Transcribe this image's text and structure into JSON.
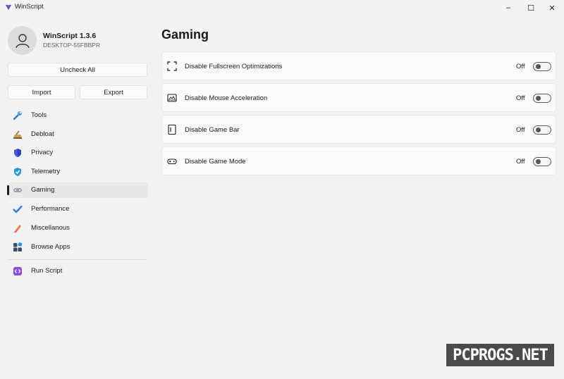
{
  "window": {
    "title": "WinScript",
    "minimize": "–",
    "maximize": "☐",
    "close": "✕"
  },
  "profile": {
    "app_name": "WinScript 1.3.6",
    "host": "DESKTOP-55FBBPR"
  },
  "actions": {
    "uncheck_all": "Uncheck All",
    "import": "Import",
    "export": "Export"
  },
  "nav": {
    "items": [
      {
        "label": "Tools",
        "icon": "wrench-icon"
      },
      {
        "label": "Debloat",
        "icon": "broom-icon"
      },
      {
        "label": "Privacy",
        "icon": "shield-icon"
      },
      {
        "label": "Telemetry",
        "icon": "shield-check-icon"
      },
      {
        "label": "Gaming",
        "icon": "gamepad-icon",
        "selected": true
      },
      {
        "label": "Performance",
        "icon": "checkmark-icon"
      },
      {
        "label": "Miscellanous",
        "icon": "pencil-icon"
      },
      {
        "label": "Browse Apps",
        "icon": "apps-icon"
      },
      {
        "label": "Run Script",
        "icon": "code-icon"
      }
    ]
  },
  "main": {
    "title": "Gaming",
    "settings": [
      {
        "label": "Disable Fullscreen Optimizations",
        "state": "Off",
        "on": false,
        "icon": "fullscreen-icon"
      },
      {
        "label": "Disable Mouse Acceleration",
        "state": "Off",
        "on": false,
        "icon": "mouse-settings-icon"
      },
      {
        "label": "Disable Game Bar",
        "state": "Off",
        "on": false,
        "icon": "game-bar-icon"
      },
      {
        "label": "Disable Game Mode",
        "state": "Off",
        "on": false,
        "icon": "controller-icon"
      }
    ]
  },
  "watermark": "PCPROGS.NET",
  "colors": {
    "background": "#f3f3f3",
    "card": "#fbfbfb",
    "selected_nav": "#e9e9e9",
    "accent": "#1b1b1b"
  }
}
